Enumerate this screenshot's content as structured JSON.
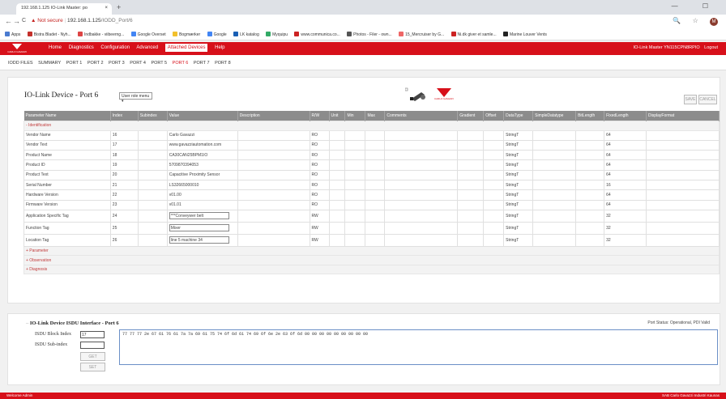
{
  "browser": {
    "tab_title": "192.168.1.125 IO-Link Master: po",
    "tab_close": "×",
    "new_tab": "+",
    "window_controls": "— ☐",
    "back": "←",
    "forward": "→",
    "reload": "C",
    "security_warning": "Not secure",
    "url_host": "192.168.1.125",
    "url_path": "/IODD_Port/6",
    "addr_icons": "🔍 ☆",
    "avatar_letter": "M",
    "bookmarks": [
      "Apps",
      "Bistra Bladet - Nyh...",
      "Indbakke - viibeerng...",
      "Google Overset",
      "Bogmærker",
      "Google",
      "LK katalog",
      "Myquipu",
      "www.communica.co...",
      "Photos - Filer - own...",
      "15_Mercruiser by G...",
      "Ni.dk giver et samle...",
      "Marine Louver Vents"
    ]
  },
  "app": {
    "logo_text": "CARLO GAVAZZI",
    "menu": [
      "Home",
      "Diagnostics",
      "Configuration",
      "Advanced",
      "Attached Devices",
      "Help"
    ],
    "active_menu": "Attached Devices",
    "device_label": "IO-Link Master YN115CPN8RPIO",
    "logout": "Logout"
  },
  "subnav": [
    "IODD FILES",
    "SUMMARY",
    "PORT 1",
    "PORT 2",
    "PORT 3",
    "PORT 4",
    "PORT 5",
    "PORT 6",
    "PORT 7",
    "PORT 8"
  ],
  "device": {
    "title": "IO-Link Device - Port 6",
    "role_menu": "User role menu ▾",
    "save": "SAVE",
    "cancel": "CANCEL",
    "logo_text": "CARLO GAVAZZI"
  },
  "table": {
    "columns": [
      "Parameter Name",
      "Index",
      "Subindex",
      "Value",
      "Description",
      "R/W",
      "Unit",
      "Min",
      "Max",
      "Comments",
      "Gradient",
      "Offset",
      "DataType",
      "SimpleDatatype",
      "BitLength",
      "FixedLength",
      "DisplayFormat"
    ],
    "group_identification": "- Identification",
    "rows": [
      {
        "name": "Vendor Name",
        "index": "16",
        "value": "Carlo Gavazzi",
        "rw": "RO",
        "dtype": "StringT",
        "len": "64"
      },
      {
        "name": "Vendor Text",
        "index": "17",
        "value": "www.gavazziautomation.com",
        "rw": "RO",
        "dtype": "StringT",
        "len": "64"
      },
      {
        "name": "Product Name",
        "index": "18",
        "value": "CA30CAN25BPM1IO",
        "rw": "RO",
        "dtype": "StringT",
        "len": "64"
      },
      {
        "name": "Product ID",
        "index": "19",
        "value": "5709870394053",
        "rw": "RO",
        "dtype": "StringT",
        "len": "64"
      },
      {
        "name": "Product Text",
        "index": "20",
        "value": "Capacitive Proximity Sensor",
        "rw": "RO",
        "dtype": "StringT",
        "len": "64"
      },
      {
        "name": "Serial Number",
        "index": "21",
        "value": "LS32665000010",
        "rw": "RO",
        "dtype": "StringT",
        "len": "16"
      },
      {
        "name": "Hardware Version",
        "index": "22",
        "value": "v01.00",
        "rw": "RO",
        "dtype": "StringT",
        "len": "64"
      },
      {
        "name": "Firmware Version",
        "index": "23",
        "value": "v01.01",
        "rw": "RO",
        "dtype": "StringT",
        "len": "64"
      }
    ],
    "edit_rows": [
      {
        "name": "Application Specific Tag",
        "index": "24",
        "value": "***Conveywer belt",
        "rw": "RW",
        "dtype": "StringT",
        "len": "32"
      },
      {
        "name": "Function Tag",
        "index": "25",
        "value": "Mixer",
        "rw": "RW",
        "dtype": "StringT",
        "len": "32"
      },
      {
        "name": "Location Tag",
        "index": "26",
        "value": "line 5 machine 34",
        "rw": "RW",
        "dtype": "StringT",
        "len": "32"
      }
    ],
    "groups_collapsed": [
      "+ Parameter",
      "+ Observation",
      "+ Diagnosis"
    ]
  },
  "isdu": {
    "title": "IO-Link Device ISDU Interface - Port 6",
    "port_status": "Port Status: Operational, PDI Valid",
    "block_index_label": "ISDU Block Index",
    "block_index_value": "17",
    "sub_index_label": "ISDU Sub-index",
    "sub_index_value": "",
    "get": "GET",
    "set": "SET",
    "hex": "77 77 77 2e 67 61 76 61 7a 7a 69 61 75 74 6f 6d 61 74 69 6f 6e 2e 63 6f 6d 00 00 00 00 00 00 00 00 00"
  },
  "footer": {
    "left": "Welcome Admin",
    "right": "SAB Carlo Gavazzi Industri Kaunas"
  }
}
